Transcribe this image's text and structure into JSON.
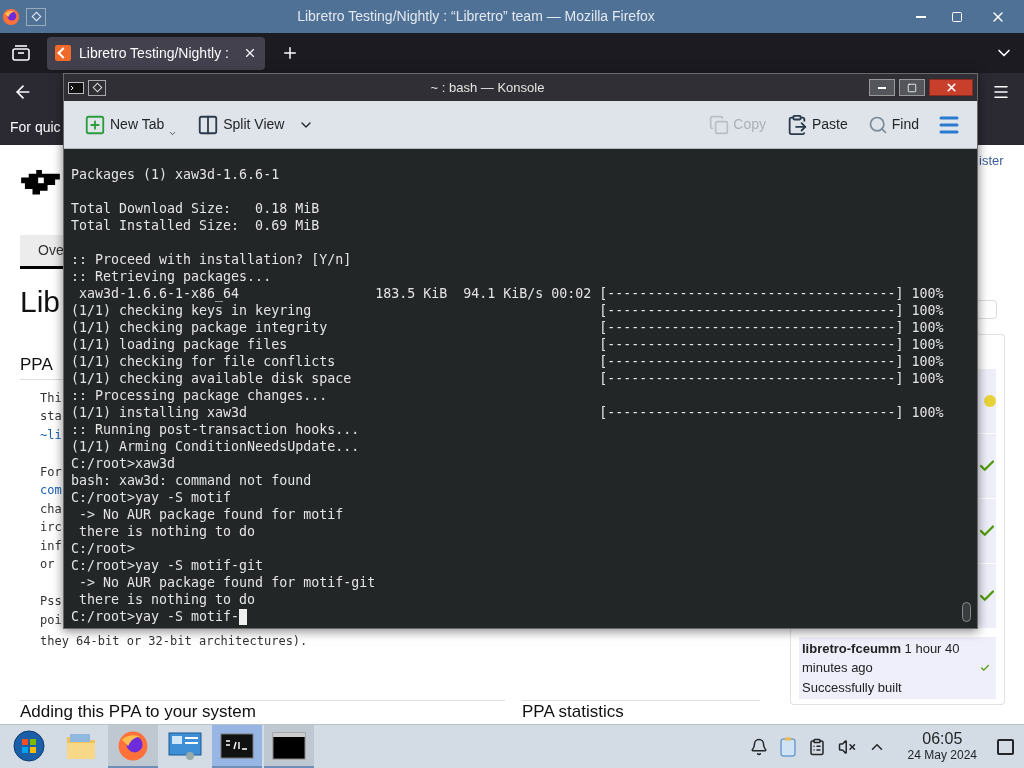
{
  "firefox": {
    "title": "Libretro Testing/Nightly : “Libretro” team — Mozilla Firefox",
    "tab": {
      "title": "Libretro Testing/Nightly :",
      "selected": true
    },
    "notice": "For quic"
  },
  "page": {
    "tab": "Ove",
    "heading": "Lib",
    "section": "PPA",
    "paragraph": [
      {
        "kind": "plain",
        "text": "Thi"
      },
      {
        "kind": "plain",
        "text": "sta"
      },
      {
        "kind": "link",
        "text": "~li"
      },
      {
        "kind": "blank"
      },
      {
        "kind": "plain",
        "text": "For"
      },
      {
        "kind": "link",
        "text": "com"
      },
      {
        "kind": "plain",
        "text": "cha"
      },
      {
        "kind": "plain",
        "text": "irc"
      },
      {
        "kind": "plain",
        "text": "inf"
      },
      {
        "kind": "plain",
        "text": "or"
      },
      {
        "kind": "blank"
      },
      {
        "kind": "plain",
        "text": "Pss"
      },
      {
        "kind": "plain",
        "text": "poi"
      }
    ],
    "last_line": "they 64-bit or 32-bit architectures).",
    "bottom_headings": [
      "Adding this PPA to your system",
      "PPA statistics"
    ],
    "login_link": "ister",
    "build_statuses": [
      {
        "succeeded": false
      },
      {
        "succeeded": true
      },
      {
        "succeeded": true
      },
      {
        "succeeded": true
      }
    ],
    "latest_build": {
      "summary": "**libretro-fceumm** 1 hour 40 minutes ago",
      "status": "Successfully built",
      "succeeded": true
    }
  },
  "konsole": {
    "title": "~ : bash — Konsole",
    "toolbar": [
      {
        "kind": "new_tab",
        "label": "New Tab",
        "disabled": false
      },
      {
        "kind": "split_view",
        "label": "Split View",
        "disabled": false
      },
      {
        "kind": "copy",
        "label": "Copy",
        "disabled": true
      },
      {
        "kind": "paste",
        "label": "Paste",
        "disabled": false
      },
      {
        "kind": "find",
        "label": "Find",
        "disabled": false
      }
    ],
    "lines": [
      {
        "kind": "text",
        "text": "Packages (1) xaw3d-1.6.6-1"
      },
      {
        "kind": "blank"
      },
      {
        "kind": "text",
        "text": "Total Download Size:   0.18 MiB"
      },
      {
        "kind": "text",
        "text": "Total Installed Size:  0.69 MiB"
      },
      {
        "kind": "blank"
      },
      {
        "kind": "text",
        "text": ":: Proceed with installation? [Y/n]"
      },
      {
        "kind": "text",
        "text": ":: Retrieving packages..."
      },
      {
        "kind": "progress",
        "text": " xaw3d-1.6.6-1-x86_64                 183.5 KiB  94.1 KiB/s 00:02",
        "bar": "[------------------------------------] 100%"
      },
      {
        "kind": "progress",
        "text": "(1/1) checking keys in keyring",
        "bar": "[------------------------------------] 100%"
      },
      {
        "kind": "progress",
        "text": "(1/1) checking package integrity",
        "bar": "[------------------------------------] 100%"
      },
      {
        "kind": "progress",
        "text": "(1/1) loading package files",
        "bar": "[------------------------------------] 100%"
      },
      {
        "kind": "progress",
        "text": "(1/1) checking for file conflicts",
        "bar": "[------------------------------------] 100%"
      },
      {
        "kind": "progress",
        "text": "(1/1) checking available disk space",
        "bar": "[------------------------------------] 100%"
      },
      {
        "kind": "text",
        "text": ":: Processing package changes..."
      },
      {
        "kind": "progress",
        "text": "(1/1) installing xaw3d",
        "bar": "[------------------------------------] 100%"
      },
      {
        "kind": "text",
        "text": ":: Running post-transaction hooks..."
      },
      {
        "kind": "text",
        "text": "(1/1) Arming ConditionNeedsUpdate..."
      },
      {
        "kind": "text",
        "text": "C:/root>xaw3d"
      },
      {
        "kind": "text",
        "text": "bash: xaw3d: command not found"
      },
      {
        "kind": "text",
        "text": "C:/root>yay -S motif"
      },
      {
        "kind": "text",
        "text": " -> No AUR package found for motif"
      },
      {
        "kind": "text",
        "text": " there is nothing to do"
      },
      {
        "kind": "text",
        "text": "C:/root>"
      },
      {
        "kind": "text",
        "text": "C:/root>yay -S motif-git"
      },
      {
        "kind": "text",
        "text": " -> No AUR package found for motif-git"
      },
      {
        "kind": "text",
        "text": " there is nothing to do"
      },
      {
        "kind": "prompt",
        "text": "C:/root>yay -S motif-"
      }
    ]
  },
  "taskbar": {
    "apps": [
      {
        "kind": "start",
        "running": false,
        "selected": false
      },
      {
        "kind": "files",
        "running": false,
        "selected": false
      },
      {
        "kind": "browser",
        "running": true,
        "selected": false
      },
      {
        "kind": "settings",
        "running": false,
        "selected": false
      },
      {
        "kind": "terminal",
        "running": true,
        "selected": true
      },
      {
        "kind": "window",
        "running": true,
        "selected": false
      }
    ],
    "time": "06:05",
    "date": "24 May 2024"
  }
}
